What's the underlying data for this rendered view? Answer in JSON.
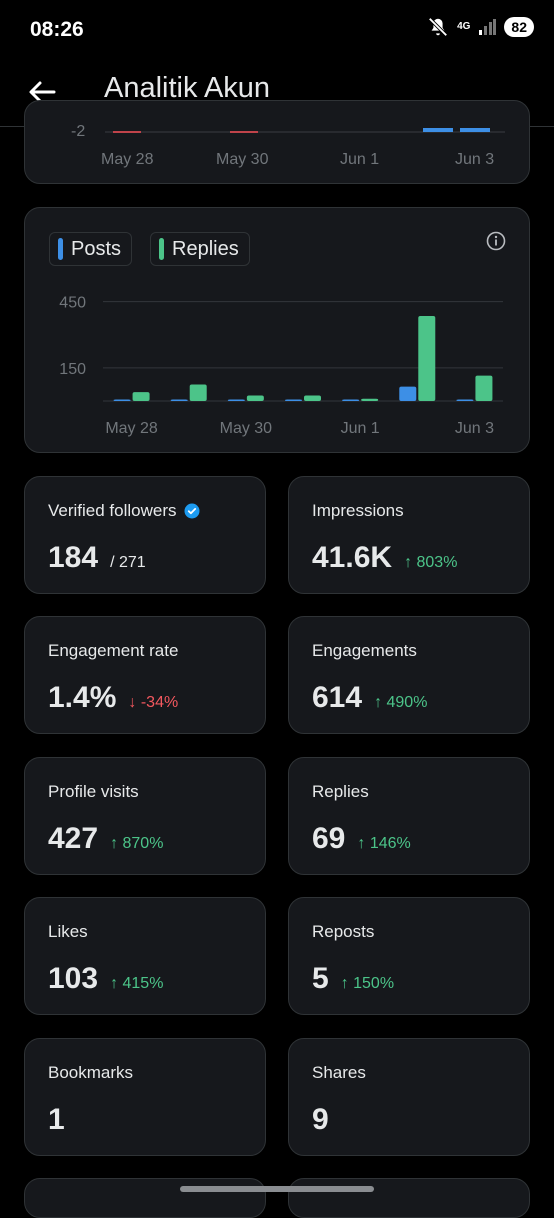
{
  "status_bar": {
    "time": "08:26",
    "network": "4G",
    "battery": "82"
  },
  "header": {
    "title": "Analitik Akun"
  },
  "top_chart": {
    "y_tick": "-2",
    "x_ticks": [
      "May 28",
      "May 30",
      "Jun 1",
      "Jun 3"
    ]
  },
  "legend": {
    "posts": "Posts",
    "replies": "Replies"
  },
  "chart_data": {
    "type": "bar",
    "categories": [
      "May 28",
      "May 29",
      "May 30",
      "May 31",
      "Jun 1",
      "Jun 2",
      "Jun 3"
    ],
    "series": [
      {
        "name": "Posts",
        "color": "#3d8fe6",
        "values": [
          3,
          3,
          2,
          0,
          2,
          65,
          3
        ]
      },
      {
        "name": "Replies",
        "color": "#4cc489",
        "values": [
          40,
          75,
          25,
          25,
          10,
          385,
          115
        ]
      }
    ],
    "yticks": [
      "450",
      "150"
    ],
    "x_tick_labels": [
      "May 28",
      "May 30",
      "Jun 1",
      "Jun 3"
    ],
    "ylim": [
      0,
      530
    ]
  },
  "stats": [
    {
      "label": "Verified followers",
      "value": "184",
      "sub": "/ 271",
      "verified": true
    },
    {
      "label": "Impressions",
      "value": "41.6K",
      "delta": "↑ 803%",
      "dir": "up"
    },
    {
      "label": "Engagement rate",
      "value": "1.4%",
      "delta": "↓ -34%",
      "dir": "down"
    },
    {
      "label": "Engagements",
      "value": "614",
      "delta": "↑ 490%",
      "dir": "up"
    },
    {
      "label": "Profile visits",
      "value": "427",
      "delta": "↑ 870%",
      "dir": "up"
    },
    {
      "label": "Replies",
      "value": "69",
      "delta": "↑ 146%",
      "dir": "up"
    },
    {
      "label": "Likes",
      "value": "103",
      "delta": "↑ 415%",
      "dir": "up"
    },
    {
      "label": "Reposts",
      "value": "5",
      "delta": "↑ 150%",
      "dir": "up"
    },
    {
      "label": "Bookmarks",
      "value": "1"
    },
    {
      "label": "Shares",
      "value": "9"
    }
  ]
}
